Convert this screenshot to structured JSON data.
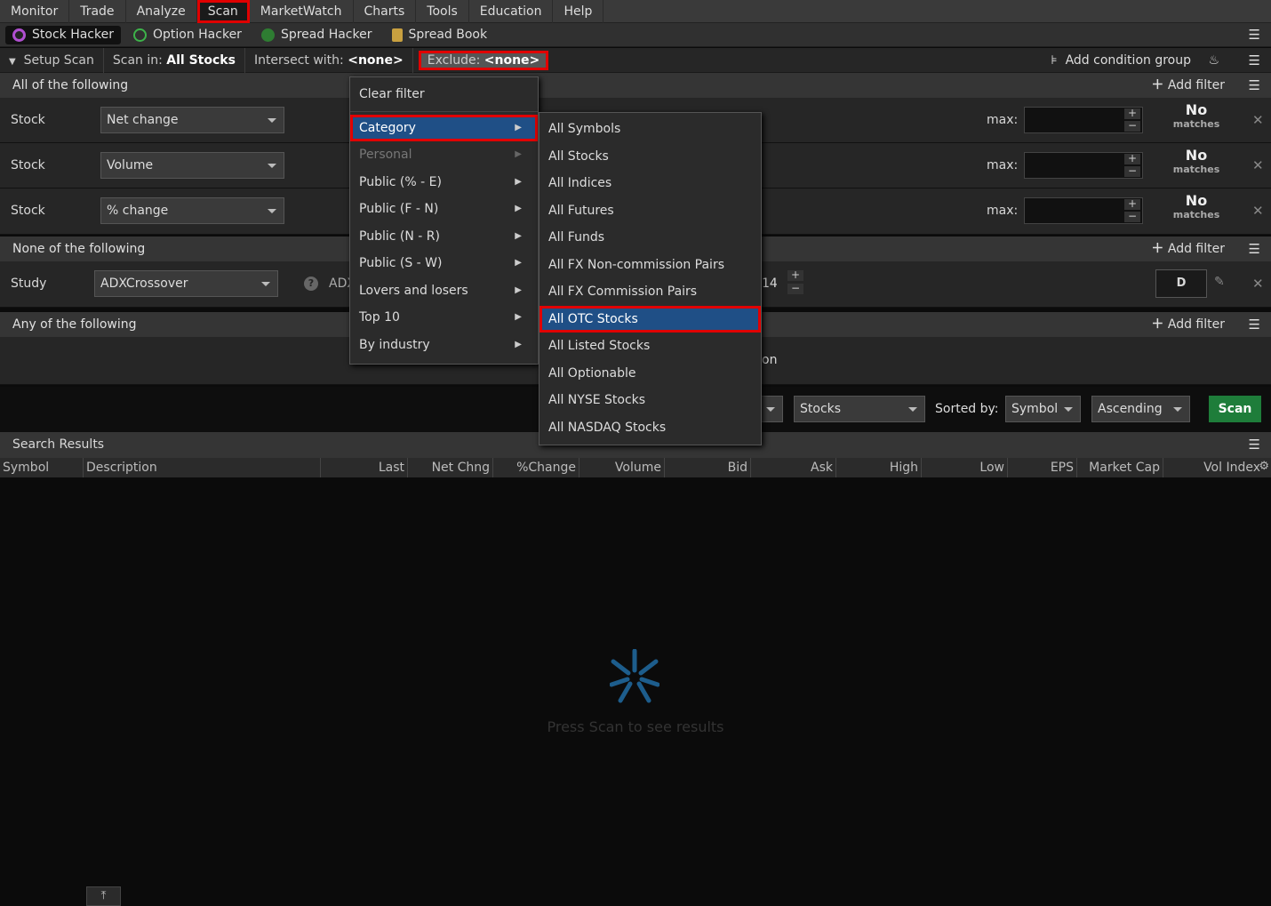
{
  "menubar": [
    "Monitor",
    "Trade",
    "Analyze",
    "Scan",
    "MarketWatch",
    "Charts",
    "Tools",
    "Education",
    "Help"
  ],
  "tabs": [
    "Stock Hacker",
    "Option Hacker",
    "Spread Hacker",
    "Spread Book"
  ],
  "setup": {
    "setup_scan": "Setup Scan",
    "scan_in_label": "Scan in:",
    "scan_in_value": "All Stocks",
    "intersect_label": "Intersect with:",
    "intersect_value": "<none>",
    "exclude_label": "Exclude:",
    "exclude_value": "<none>",
    "add_condition_group": "Add condition group"
  },
  "groups": {
    "all": "All of the following",
    "none": "None of the following",
    "any": "Any of the following",
    "add_filter": "Add filter"
  },
  "filters": [
    {
      "type": "Stock",
      "field": "Net change",
      "max_label": "max:",
      "no": "No",
      "matches": "matches"
    },
    {
      "type": "Stock",
      "field": "Volume",
      "max_label": "max:",
      "no": "No",
      "matches": "matches"
    },
    {
      "type": "Stock",
      "field": "% change",
      "max_label": "max:",
      "no": "No",
      "matches": "matches"
    }
  ],
  "study": {
    "type": "Study",
    "field": "ADXCrossover",
    "partial": "ADX",
    "length": "14",
    "agg": "D"
  },
  "any_row_text": "on",
  "bottom": {
    "stocks": "Stocks",
    "sorted_by": "Sorted by:",
    "sort_field": "Symbol",
    "sort_order": "Ascending",
    "scan": "Scan"
  },
  "results": {
    "title": "Search Results",
    "columns": [
      "Symbol",
      "Description",
      "Last",
      "Net Chng",
      "%Change",
      "Volume",
      "Bid",
      "Ask",
      "High",
      "Low",
      "EPS",
      "Market Cap",
      "Vol Index"
    ],
    "empty_text": "Press Scan to see results"
  },
  "dropdown": {
    "clear": "Clear filter",
    "items": [
      "Category",
      "Personal",
      "Public (% - E)",
      "Public (F - N)",
      "Public (N - R)",
      "Public (S - W)",
      "Lovers and losers",
      "Top 10",
      "By industry"
    ]
  },
  "submenu": [
    "All Symbols",
    "All Stocks",
    "All Indices",
    "All Futures",
    "All Funds",
    "All FX Non-commission Pairs",
    "All FX Commission Pairs",
    "All OTC Stocks",
    "All Listed Stocks",
    "All Optionable",
    "All NYSE Stocks",
    "All NASDAQ Stocks"
  ],
  "colors": {
    "highlight": "#1f4f86",
    "annotation": "#e00000",
    "scan_button": "#1e7d3a"
  }
}
